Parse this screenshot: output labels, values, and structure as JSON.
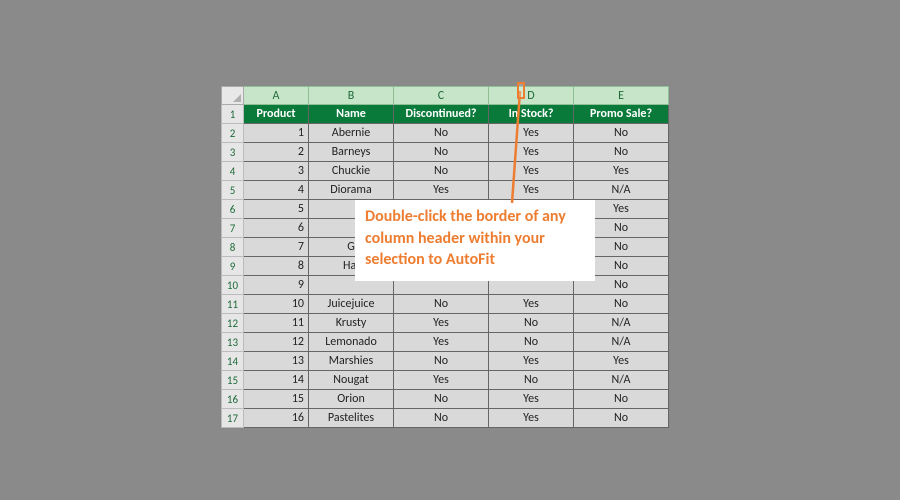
{
  "columns": [
    "A",
    "B",
    "C",
    "D",
    "E"
  ],
  "headers": {
    "A": "Product",
    "B": "Name",
    "C": "Discontinued?",
    "D": "In Stock?",
    "E": "Promo Sale?"
  },
  "rows": [
    {
      "A": "1",
      "B": "Abernie",
      "C": "No",
      "D": "Yes",
      "E": "No"
    },
    {
      "A": "2",
      "B": "Barneys",
      "C": "No",
      "D": "Yes",
      "E": "No"
    },
    {
      "A": "3",
      "B": "Chuckie",
      "C": "No",
      "D": "Yes",
      "E": "Yes"
    },
    {
      "A": "4",
      "B": "Diorama",
      "C": "Yes",
      "D": "Yes",
      "E": "N/A"
    },
    {
      "A": "5",
      "B": "",
      "C": "",
      "D": "",
      "E": "Yes"
    },
    {
      "A": "6",
      "B": "",
      "C": "",
      "D": "",
      "E": "No"
    },
    {
      "A": "7",
      "B": "G",
      "C": "",
      "D": "",
      "E": "No"
    },
    {
      "A": "8",
      "B": "Hal",
      "C": "",
      "D": "",
      "E": "No"
    },
    {
      "A": "9",
      "B": "",
      "C": "",
      "D": "",
      "E": "No"
    },
    {
      "A": "10",
      "B": "Juicejuice",
      "C": "No",
      "D": "Yes",
      "E": "No"
    },
    {
      "A": "11",
      "B": "Krusty",
      "C": "Yes",
      "D": "No",
      "E": "N/A"
    },
    {
      "A": "12",
      "B": "Lemonado",
      "C": "Yes",
      "D": "No",
      "E": "N/A"
    },
    {
      "A": "13",
      "B": "Marshies",
      "C": "No",
      "D": "Yes",
      "E": "Yes"
    },
    {
      "A": "14",
      "B": "Nougat",
      "C": "Yes",
      "D": "No",
      "E": "N/A"
    },
    {
      "A": "15",
      "B": "Orion",
      "C": "No",
      "D": "Yes",
      "E": "No"
    },
    {
      "A": "16",
      "B": "Pastelites",
      "C": "No",
      "D": "Yes",
      "E": "No"
    }
  ],
  "annotation": {
    "text": "Double-click the border of any column header within your selection to AutoFit"
  },
  "chart_data": {
    "type": "table",
    "title": "",
    "columns": [
      "Product",
      "Name",
      "Discontinued?",
      "In Stock?",
      "Promo Sale?"
    ],
    "rows": [
      [
        1,
        "Abernie",
        "No",
        "Yes",
        "No"
      ],
      [
        2,
        "Barneys",
        "No",
        "Yes",
        "No"
      ],
      [
        3,
        "Chuckie",
        "No",
        "Yes",
        "Yes"
      ],
      [
        4,
        "Diorama",
        "Yes",
        "Yes",
        "N/A"
      ],
      [
        5,
        null,
        null,
        null,
        "Yes"
      ],
      [
        6,
        null,
        null,
        null,
        "No"
      ],
      [
        7,
        null,
        null,
        null,
        "No"
      ],
      [
        8,
        null,
        null,
        null,
        "No"
      ],
      [
        9,
        null,
        null,
        null,
        "No"
      ],
      [
        10,
        "Juicejuice",
        "No",
        "Yes",
        "No"
      ],
      [
        11,
        "Krusty",
        "Yes",
        "No",
        "N/A"
      ],
      [
        12,
        "Lemonado",
        "Yes",
        "No",
        "N/A"
      ],
      [
        13,
        "Marshies",
        "No",
        "Yes",
        "Yes"
      ],
      [
        14,
        "Nougat",
        "Yes",
        "No",
        "N/A"
      ],
      [
        15,
        "Orion",
        "No",
        "Yes",
        "No"
      ],
      [
        16,
        "Pastelites",
        "No",
        "Yes",
        "No"
      ]
    ]
  }
}
